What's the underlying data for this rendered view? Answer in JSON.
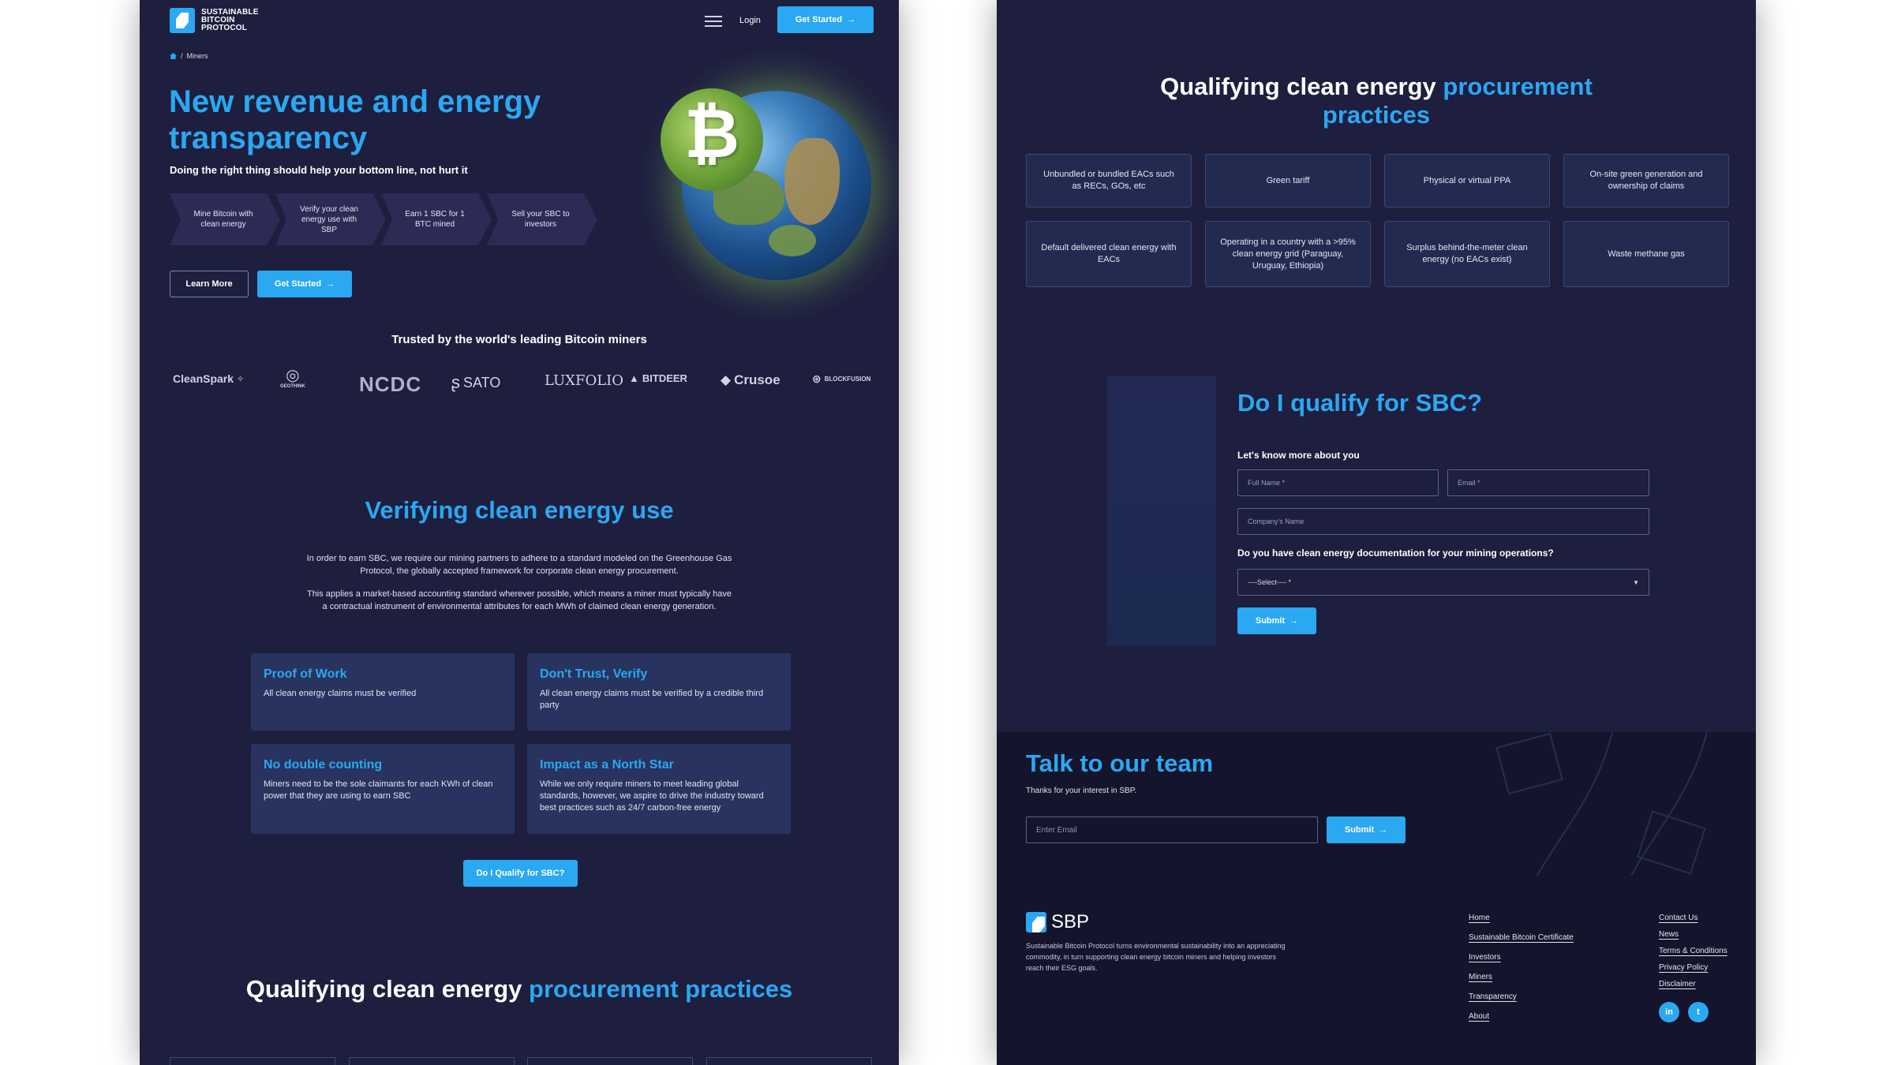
{
  "left": {
    "logo_text": [
      "SUSTAINABLE",
      "BITCOIN",
      "PROTOCOL"
    ],
    "nav": {
      "login": "Login",
      "get_started": "Get Started"
    },
    "breadcrumb": {
      "separator": "/",
      "current": "Miners"
    },
    "hero": {
      "title": "New revenue and energy transparency",
      "subtitle": "Doing the right thing should help your bottom line, not hurt it",
      "steps": [
        "Mine Bitcoin with clean energy",
        "Verify your clean energy use with SBP",
        "Earn 1 SBC for 1 BTC mined",
        "Sell your SBC to investors"
      ],
      "learn_more": "Learn More",
      "get_started": "Get Started",
      "coin_symbol": "₿"
    },
    "trusted": {
      "heading": "Trusted by the world's leading Bitcoin miners",
      "partners": [
        "CleanSpark",
        "GEOTHINK",
        "NCDC",
        "SATO",
        "LUXFOLIO",
        "BITDEER",
        "Crusoe",
        "BLOCKFUSION"
      ]
    },
    "verifying": {
      "title": "Verifying clean energy use",
      "p1": "In order to earn SBC, we require our mining partners to adhere to a standard modeled on the Greenhouse Gas Protocol, the globally accepted framework for corporate clean energy procurement.",
      "p2": "This applies a market-based accounting standard wherever possible, which means a miner must typically have a contractual instrument of environmental attributes for each MWh of claimed clean energy generation.",
      "cards": [
        {
          "title": "Proof of Work",
          "text": "All clean energy claims must be verified"
        },
        {
          "title": "Don't Trust, Verify",
          "text": "All clean energy claims must be verified by a credible third party"
        },
        {
          "title": "No double counting",
          "text": "Miners need to be the sole claimants for each KWh of clean power that they are using to earn SBC"
        },
        {
          "title": "Impact as a North Star",
          "text": "While we only require miners to meet leading global standards, however, we aspire to drive the industry toward best practices such as 24/7 carbon-free energy"
        }
      ],
      "cta": "Do I Qualify for SBC?"
    },
    "qualifying": {
      "title_white": "Qualifying clean energy",
      "title_accent": "procurement practices"
    }
  },
  "right": {
    "qualifying": {
      "title_white": "Qualifying clean energy",
      "title_accent": "procurement practices",
      "items": [
        "Unbundled or bundled EACs such as RECs, GOs, etc",
        "Green tariff",
        "Physical or virtual PPA",
        "On-site green generation and ownership of claims",
        "Default delivered clean energy with EACs",
        "Operating in a country with a >95% clean energy grid (Paraguay, Uruguay, Ethiopia)",
        "Surplus behind-the-meter clean energy (no EACs exist)",
        "Waste methane gas"
      ]
    },
    "form": {
      "title": "Do I qualify for SBC?",
      "intro": "Let's know more about you",
      "full_name": "Full Name *",
      "email": "Email *",
      "company": "Company's Name",
      "question": "Do you have clean energy documentation for your mining operations?",
      "select": "----Select---- *",
      "submit": "Submit"
    },
    "team": {
      "title": "Talk to our team",
      "subtitle": "Thanks for your interest in SBP.",
      "email_placeholder": "Enter Email",
      "submit": "Submit"
    },
    "footer": {
      "logo": "SBP",
      "description": "Sustainable Bitcoin Protocol turns environmental sustainability into an appreciating commodity, in turn supporting clean energy bitcoin miners and helping investors reach their ESG goals.",
      "links_col1": [
        "Home",
        "Sustainable Bitcoin Certificate",
        "Investors",
        "Miners",
        "Transparency",
        "About"
      ],
      "links_col2": [
        "Contact Us",
        "News",
        "Terms & Conditions",
        "Privacy Policy",
        "Disclaimer"
      ],
      "social": [
        "in",
        "t"
      ]
    }
  }
}
